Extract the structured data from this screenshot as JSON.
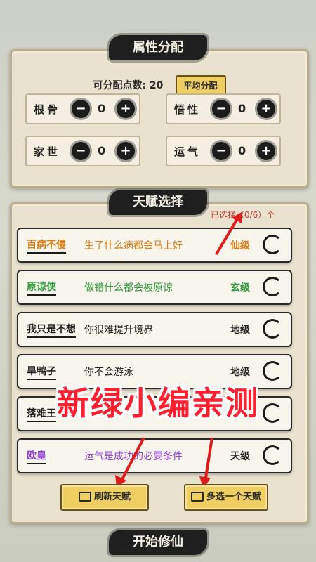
{
  "attributes_section": {
    "title": "属性分配",
    "points_label": "可分配点数: 20",
    "avg_button": "平均分配",
    "items": [
      {
        "label": "根骨",
        "value": "0"
      },
      {
        "label": "悟性",
        "value": "0"
      },
      {
        "label": "家世",
        "value": "0"
      },
      {
        "label": "运气",
        "value": "0"
      }
    ],
    "minus_symbol": "−",
    "plus_symbol": "+"
  },
  "talent_section": {
    "title": "天赋选择",
    "selected_label": "已选择（0/6）个",
    "items": [
      {
        "name": "百病不侵",
        "desc": "生了什么病都会马上好",
        "grade": "仙级",
        "color": "#d9790f"
      },
      {
        "name": "原谅侠",
        "desc": "做错什么都会被原谅",
        "grade": "玄级",
        "color": "#2e9a3a"
      },
      {
        "name": "我只是不想",
        "desc": "你很难提升境界",
        "grade": "地级",
        "color": "#222222"
      },
      {
        "name": "旱鸭子",
        "desc": "你不会游泳",
        "grade": "地级",
        "color": "#222222"
      },
      {
        "name": "落难王",
        "desc": "",
        "grade": "",
        "color": "#222222"
      },
      {
        "name": "欧皇",
        "desc": "运气是成功的必要条件",
        "grade": "天级",
        "color": "#8e3fd6"
      }
    ]
  },
  "buttons": {
    "refresh": "刷新天赋",
    "multi": "多选一个天赋",
    "start": "开始修仙"
  },
  "watermark": "新绿小编亲测",
  "colors": {
    "accent_gold": "#f0cf62",
    "ink": "#1f1f1f",
    "red_text": "#c0392b",
    "watermark": "#ff1f2e"
  }
}
